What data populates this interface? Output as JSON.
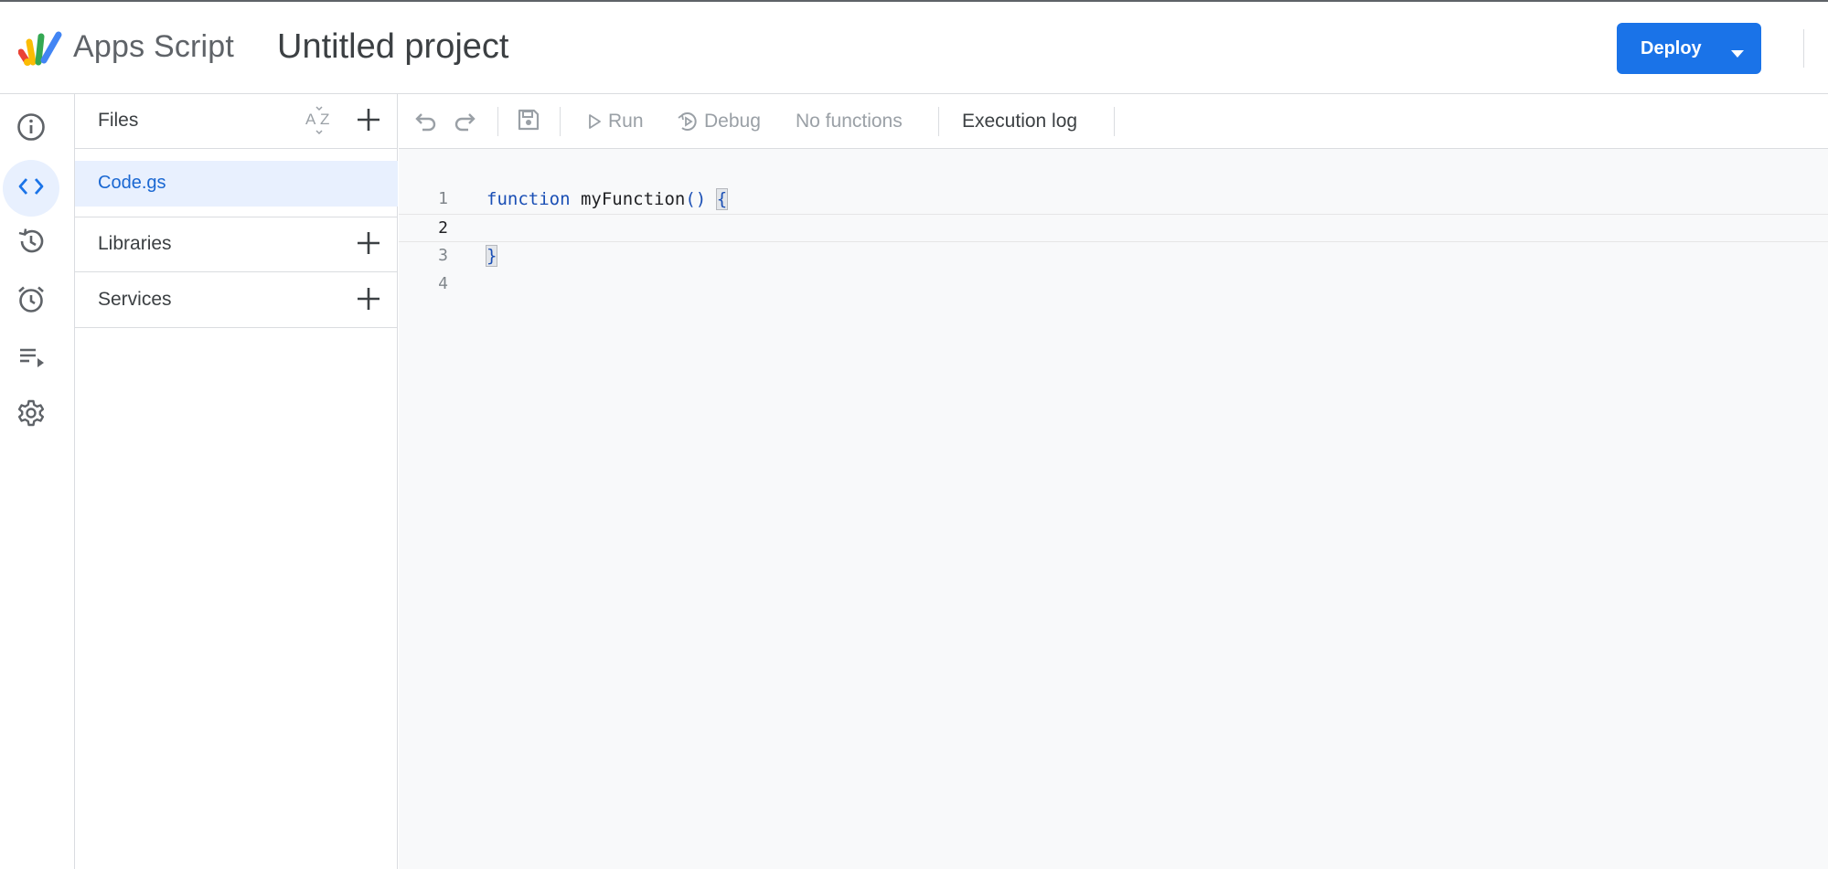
{
  "header": {
    "app_name": "Apps Script",
    "project_title": "Untitled project",
    "deploy_label": "Deploy"
  },
  "rail": {
    "items": [
      {
        "name": "overview",
        "icon": "info-icon"
      },
      {
        "name": "editor",
        "icon": "code-icon",
        "active": true
      },
      {
        "name": "project-history",
        "icon": "history-icon"
      },
      {
        "name": "triggers",
        "icon": "alarm-clock-icon"
      },
      {
        "name": "executions",
        "icon": "executions-list-icon"
      },
      {
        "name": "project-settings",
        "icon": "gear-icon"
      }
    ]
  },
  "files_panel": {
    "files_label": "Files",
    "files": [
      {
        "name": "Code.gs"
      }
    ],
    "libraries_label": "Libraries",
    "services_label": "Services"
  },
  "toolbar": {
    "run_label": "Run",
    "debug_label": "Debug",
    "function_select": "No functions",
    "execution_log_label": "Execution log"
  },
  "editor": {
    "lines": [
      {
        "number": "1",
        "keyword": "function",
        "name": " myFunction",
        "parens": "()",
        "sep": " ",
        "brace": "{"
      },
      {
        "number": "2"
      },
      {
        "number": "3",
        "brace": "}"
      },
      {
        "number": "4"
      }
    ]
  },
  "colors": {
    "accent": "#1a73e8",
    "active_bg": "#e8f0fe",
    "editor_bg": "#f8f9fa",
    "keyword": "#1a4fb5"
  }
}
